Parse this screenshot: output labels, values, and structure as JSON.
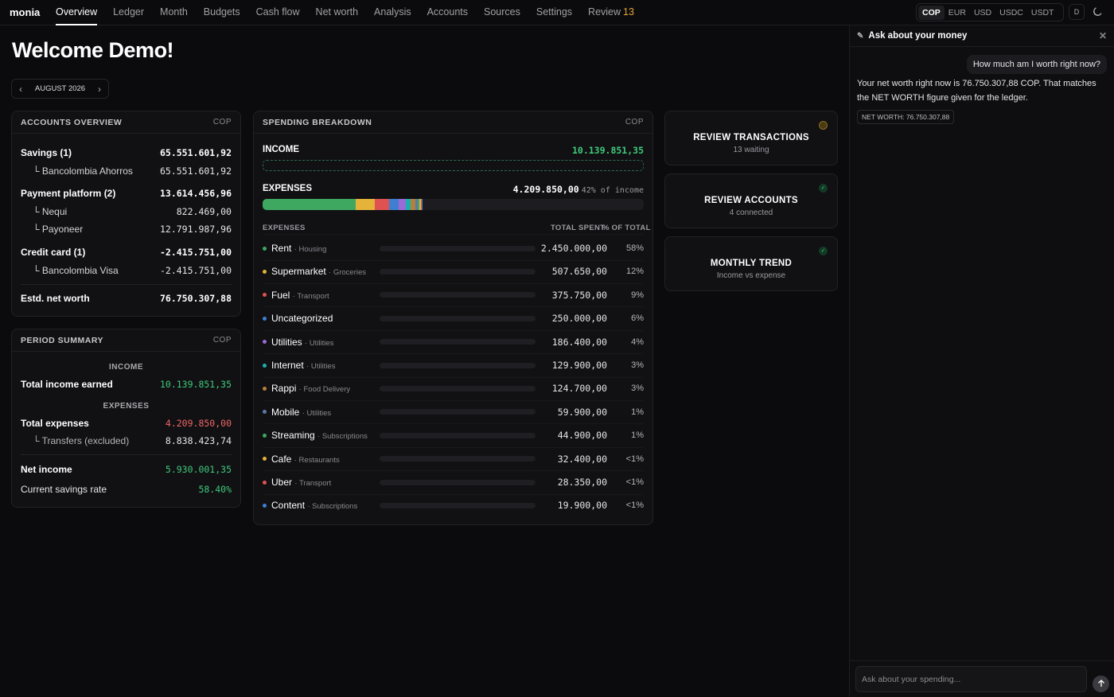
{
  "app": {
    "logo": "monia"
  },
  "nav": {
    "items": [
      {
        "label": "Overview",
        "active": true
      },
      {
        "label": "Ledger"
      },
      {
        "label": "Month"
      },
      {
        "label": "Budgets"
      },
      {
        "label": "Cash flow"
      },
      {
        "label": "Net worth"
      },
      {
        "label": "Analysis"
      },
      {
        "label": "Accounts"
      },
      {
        "label": "Sources"
      },
      {
        "label": "Settings"
      }
    ],
    "review_label": "Review",
    "review_count": "13"
  },
  "currencies": {
    "options": [
      "COP",
      "EUR",
      "USD",
      "USDC",
      "USDT"
    ],
    "selected": "COP"
  },
  "user": {
    "initial": "D"
  },
  "page": {
    "welcome": "Welcome Demo!",
    "period": "AUGUST 2026",
    "prev": "‹",
    "next": "›"
  },
  "accounts_overview": {
    "title": "ACCOUNTS OVERVIEW",
    "currency": "COP",
    "groups": [
      {
        "label": "Savings (1)",
        "value": "65.551.601,92"
      },
      {
        "label": "└ Bancolombia Ahorros",
        "value": "65.551.601,92"
      },
      {
        "label": "Payment platform (2)",
        "value": "13.614.456,96"
      },
      {
        "label": "└ Nequi",
        "value": "822.469,00"
      },
      {
        "label": "└ Payoneer",
        "value": "12.791.987,96"
      },
      {
        "label": "Credit card (1)",
        "value": "-2.415.751,00"
      },
      {
        "label": "└ Bancolombia Visa",
        "value": "-2.415.751,00"
      }
    ],
    "net_worth_label": "Estd. net worth",
    "net_worth_value": "76.750.307,88"
  },
  "period_summary": {
    "title": "PERIOD SUMMARY",
    "currency": "COP",
    "income_section": "INCOME",
    "total_income_label": "Total income earned",
    "total_income_value": "10.139.851,35",
    "expenses_section": "EXPENSES",
    "total_expenses_label": "Total expenses",
    "total_expenses_value": "4.209.850,00",
    "transfers_label": "└ Transfers (excluded)",
    "transfers_value": "8.838.423,74",
    "net_income_label": "Net income",
    "net_income_value": "5.930.001,35",
    "savings_rate_label": "Current savings rate",
    "savings_rate_value": "58.40%"
  },
  "spending": {
    "title": "SPENDING BREAKDOWN",
    "currency": "COP",
    "income_label": "INCOME",
    "income_value": "10.139.851,35",
    "expenses_label": "EXPENSES",
    "expenses_value": "4.209.850,00",
    "expenses_pct_of_income": "42% of income",
    "col_expenses": "EXPENSES",
    "col_total": "TOTAL SPENT",
    "col_pct": "% OF TOTAL",
    "rows": [
      {
        "name": "Rent",
        "category": "· Housing",
        "amount": "2.450.000,00",
        "pct": "58%",
        "share": 0.58,
        "color": "#3ea860"
      },
      {
        "name": "Supermarket",
        "category": "· Groceries",
        "amount": "507.650,00",
        "pct": "12%",
        "share": 0.12,
        "color": "#e5b23a"
      },
      {
        "name": "Fuel",
        "category": "· Transport",
        "amount": "375.750,00",
        "pct": "9%",
        "share": 0.09,
        "color": "#e05252"
      },
      {
        "name": "Uncategorized",
        "category": "",
        "amount": "250.000,00",
        "pct": "6%",
        "share": 0.06,
        "color": "#3f7fd1"
      },
      {
        "name": "Utilities",
        "category": "· Utilities",
        "amount": "186.400,00",
        "pct": "4%",
        "share": 0.044,
        "color": "#9a6ad6"
      },
      {
        "name": "Internet",
        "category": "· Utilities",
        "amount": "129.900,00",
        "pct": "3%",
        "share": 0.031,
        "color": "#1bb0b0"
      },
      {
        "name": "Rappi",
        "category": "· Food Delivery",
        "amount": "124.700,00",
        "pct": "3%",
        "share": 0.03,
        "color": "#b5813a"
      },
      {
        "name": "Mobile",
        "category": "· Utilities",
        "amount": "59.900,00",
        "pct": "1%",
        "share": 0.014,
        "color": "#5a7aa8"
      },
      {
        "name": "Streaming",
        "category": "· Subscriptions",
        "amount": "44.900,00",
        "pct": "1%",
        "share": 0.011,
        "color": "#3ea860"
      },
      {
        "name": "Cafe",
        "category": "· Restaurants",
        "amount": "32.400,00",
        "pct": "<1%",
        "share": 0.008,
        "color": "#e5b23a"
      },
      {
        "name": "Uber",
        "category": "· Transport",
        "amount": "28.350,00",
        "pct": "<1%",
        "share": 0.007,
        "color": "#e05252"
      },
      {
        "name": "Content",
        "category": "· Subscriptions",
        "amount": "19.900,00",
        "pct": "<1%",
        "share": 0.005,
        "color": "#3f7fd1"
      }
    ]
  },
  "actions": [
    {
      "title": "REVIEW TRANSACTIONS",
      "subtitle": "13 waiting",
      "status": "pending"
    },
    {
      "title": "REVIEW ACCOUNTS",
      "subtitle": "4 connected",
      "status": "ok"
    },
    {
      "title": "MONTHLY TREND",
      "subtitle": "Income vs expense",
      "status": "ok"
    }
  ],
  "chat": {
    "title": "Ask about your money",
    "user_message": "How much am I worth right now?",
    "bot_message": "Your net worth right now is 76.750.307,88 COP. That matches the NET WORTH figure given for the ledger.",
    "chip": "NET WORTH: 76.750.307,88",
    "input_placeholder": "Ask about your spending..."
  }
}
